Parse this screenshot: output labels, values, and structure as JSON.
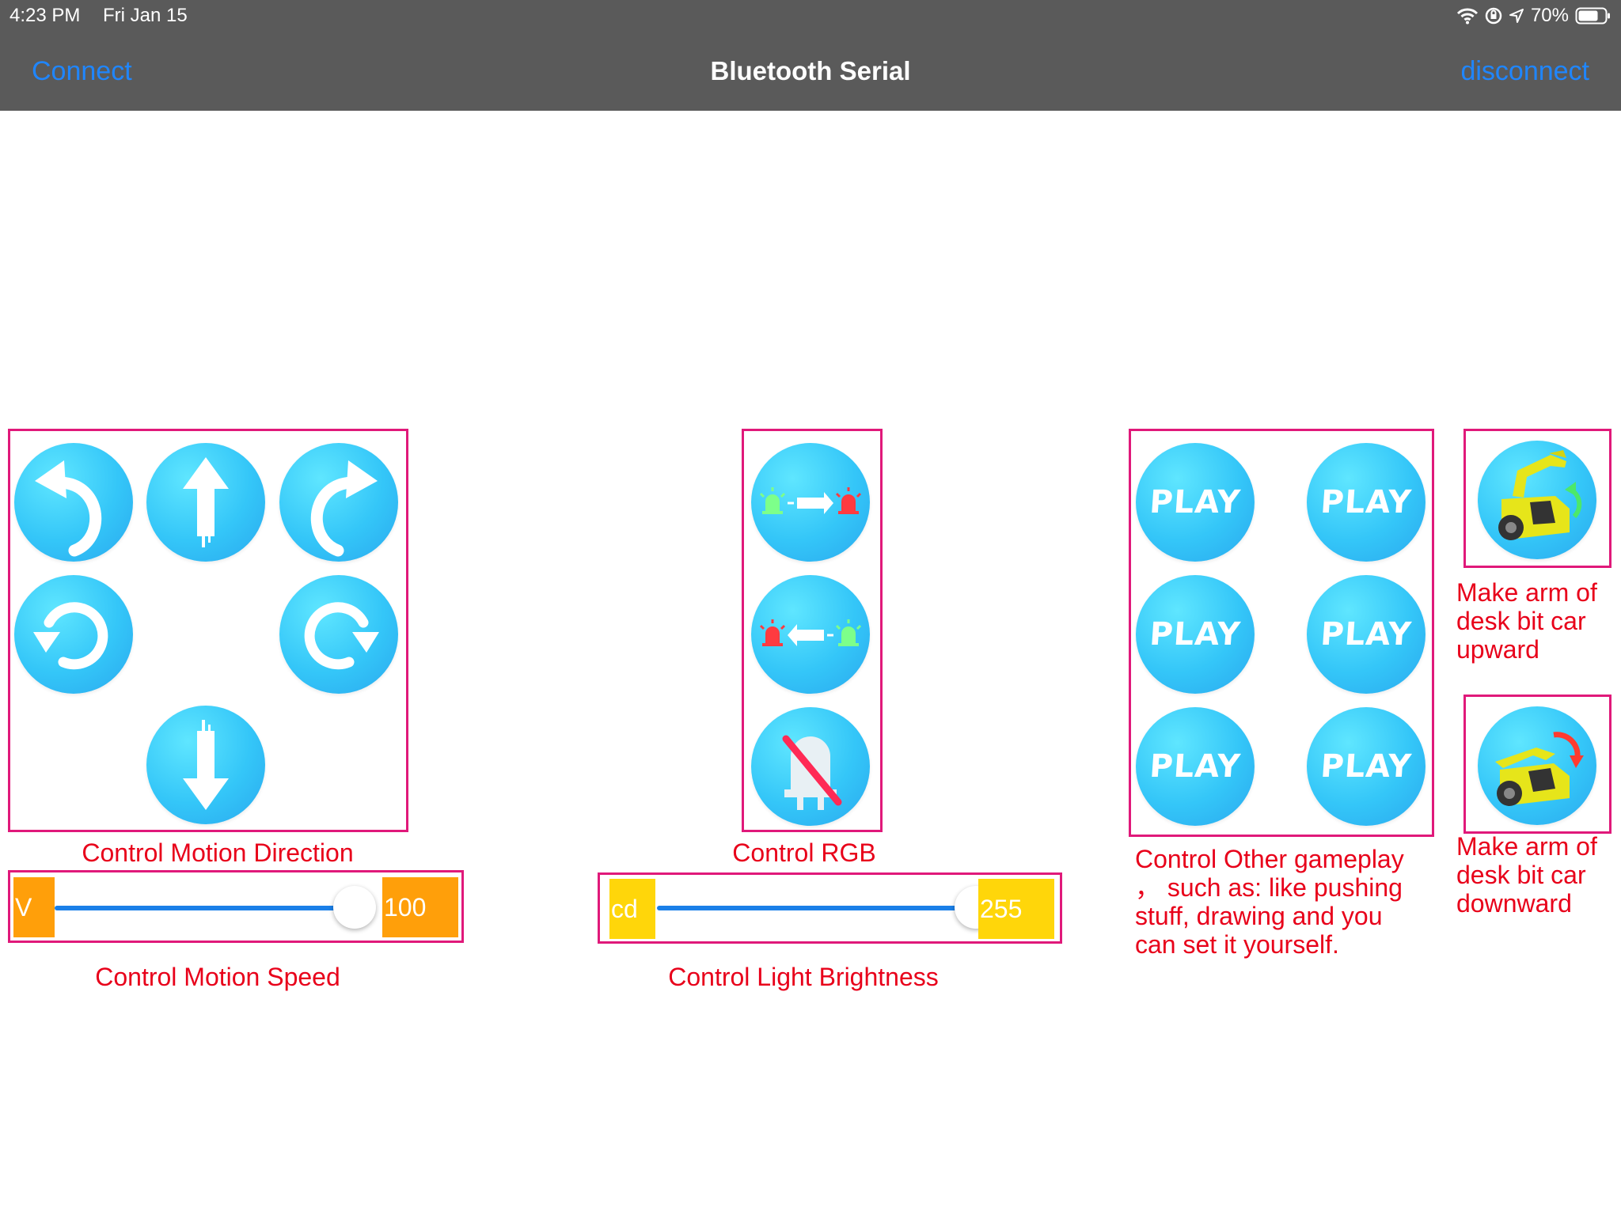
{
  "status_bar": {
    "time": "4:23 PM",
    "date": "Fri Jan 15",
    "battery": "70%"
  },
  "nav": {
    "connect": "Connect",
    "title": "Bluetooth Serial",
    "disconnect": "disconnect"
  },
  "direction": {
    "caption": "Control Motion Direction",
    "buttons": [
      "turn-left-icon",
      "forward-icon",
      "turn-right-icon",
      "rotate-left-icon",
      "rotate-right-icon",
      "backward-icon"
    ]
  },
  "rgb": {
    "caption": "Control RGB",
    "buttons": [
      "rgb-next-icon",
      "rgb-previous-icon",
      "rgb-off-icon"
    ]
  },
  "gameplay": {
    "buttons": [
      "PLAY 1",
      "PLAY 2",
      "PLAY 3",
      "PLAY 4",
      "PLAY 5",
      "PLAY 6"
    ],
    "caption_lines": [
      "Control Other gameplay",
      "，  such as: like pushing",
      "stuff, drawing and you",
      "can set it yourself."
    ]
  },
  "arm": {
    "up_caption_lines": [
      "Make arm of",
      "desk bit car",
      "upward"
    ],
    "down_caption_lines": [
      "Make arm of",
      "desk bit car",
      "downward"
    ]
  },
  "speed_slider": {
    "left_label": "V",
    "value": "100",
    "fraction": 0.9,
    "caption": "Control Motion Speed",
    "color": "#ff9f0a"
  },
  "brightness_slider": {
    "left_label": "cd",
    "value": "255",
    "fraction": 0.95,
    "caption": "Control Light Brightness",
    "color": "#ffd60a"
  },
  "colors": {
    "accent_blue": "#1f86ff",
    "frame_pink": "#e0197a",
    "caption_red": "#e8001a",
    "button_cyan": "#34c6f8",
    "car_yellow": "#e6e51a"
  }
}
